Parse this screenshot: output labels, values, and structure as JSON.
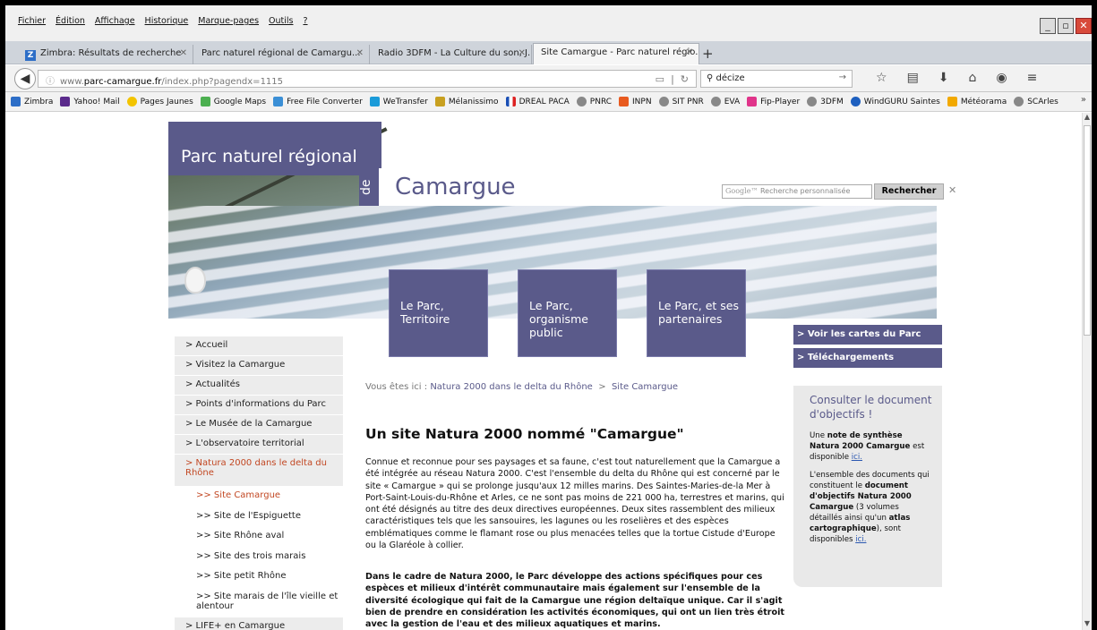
{
  "browser": {
    "menu": [
      "Fichier",
      "Édition",
      "Affichage",
      "Historique",
      "Marque-pages",
      "Outils",
      "?"
    ],
    "tabs": [
      {
        "label": "Zimbra: Résultats de recherche",
        "active": false
      },
      {
        "label": "Parc naturel régional de Camargu...",
        "active": false
      },
      {
        "label": "Radio 3DFM - La Culture du son, J...",
        "active": false
      },
      {
        "label": "Site Camargue - Parc naturel régio...",
        "active": true
      }
    ],
    "url_prefix": "www.",
    "url_domain": "parc-camargue.fr",
    "url_path": "/index.php?pagendx=1115",
    "search_value": "décize",
    "bookmarks": [
      "Zimbra",
      "Yahoo! Mail",
      "Pages Jaunes",
      "Google Maps",
      "Free File Converter",
      "WeTransfer",
      "Mélanissimo",
      "DREAL PACA",
      "PNRC",
      "INPN",
      "SIT PNR",
      "EVA",
      "Fip-Player",
      "3DFM",
      "WindGURU Saintes",
      "Météorama",
      "SCArles"
    ]
  },
  "site": {
    "brand_top": "Parc naturel régional",
    "brand_de": "de",
    "brand_main": "Camargue",
    "google_placeholder": "Recherche personnalisée",
    "google_logo": "Google™",
    "search_button": "Rechercher",
    "blue_boxes": [
      "Le Parc, Territoire",
      "Le Parc, organisme public",
      "Le Parc, et ses partenaires"
    ],
    "side_buttons": [
      "> Voir les cartes du Parc",
      "> Téléchargements"
    ],
    "nav": [
      {
        "label": "> Accueil"
      },
      {
        "label": "> Visitez la Camargue"
      },
      {
        "label": "> Actualités"
      },
      {
        "label": "> Points d'informations du Parc"
      },
      {
        "label": "> Le Musée de la Camargue"
      },
      {
        "label": "> L'observatoire territorial"
      },
      {
        "label": "> Natura 2000 dans le delta du Rhône"
      },
      {
        "label": ">> Site Camargue"
      },
      {
        "label": ">> Site de l'Espiguette"
      },
      {
        "label": ">> Site Rhône aval"
      },
      {
        "label": ">> Site des trois marais"
      },
      {
        "label": ">> Site petit Rhône"
      },
      {
        "label": ">> Site marais de l'île vieille et alentour"
      },
      {
        "label": "> LIFE+ en Camargue"
      }
    ],
    "breadcrumb_prefix": "Vous êtes ici :",
    "breadcrumb_link1": "Natura 2000 dans le delta du Rhône",
    "breadcrumb_sep": ">",
    "breadcrumb_link2": "Site Camargue",
    "title": "Un site Natura 2000 nommé \"Camargue\"",
    "para1": "Connue et reconnue pour ses paysages et sa faune, c'est tout naturellement que la Camargue a été intégrée au réseau Natura 2000. C'est l'ensemble du delta du Rhône qui est concerné par le site « Camargue » qui se prolonge jusqu'aux 12 milles marins. Des Saintes-Maries-de-la Mer à Port-Saint-Louis-du-Rhône et Arles, ce ne sont pas moins de 221 000 ha, terrestres et marins, qui ont été désignés au titre des deux directives européennes. Deux sites rassemblent des milieux caractéristiques tels que les sansouires, les lagunes ou les roselières et des espèces emblématiques comme le flamant rose ou plus menacées telles que la tortue Cistude d'Europe ou la Glaréole à collier.",
    "para2": "Dans le cadre de Natura 2000, le Parc développe des actions spécifiques pour ces espèces et milieux d'intérêt communautaire mais également sur l'ensemble de la diversité écologique qui fait de la Camargue une région deltaïque unique. Car il s'agit bien de prendre en considération les activités économiques, qui ont un lien très étroit avec la gestion de l'eau et des milieux aquatiques et marins.",
    "infobox_title": "Consulter le document d'objectifs !",
    "infobox_p1_a": "Une ",
    "infobox_p1_b": "note de synthèse Natura 2000 Camargue",
    "infobox_p1_c": " est disponible ",
    "infobox_link": "ici.",
    "infobox_p2_a": "L'ensemble des documents qui constituent le ",
    "infobox_p2_b": "document d'objectifs Natura 2000 Camargue",
    "infobox_p2_c": " (3 volumes détaillés ainsi qu'un ",
    "infobox_p2_d": "atlas cartographique",
    "infobox_p2_e": "), sont disponibles "
  }
}
